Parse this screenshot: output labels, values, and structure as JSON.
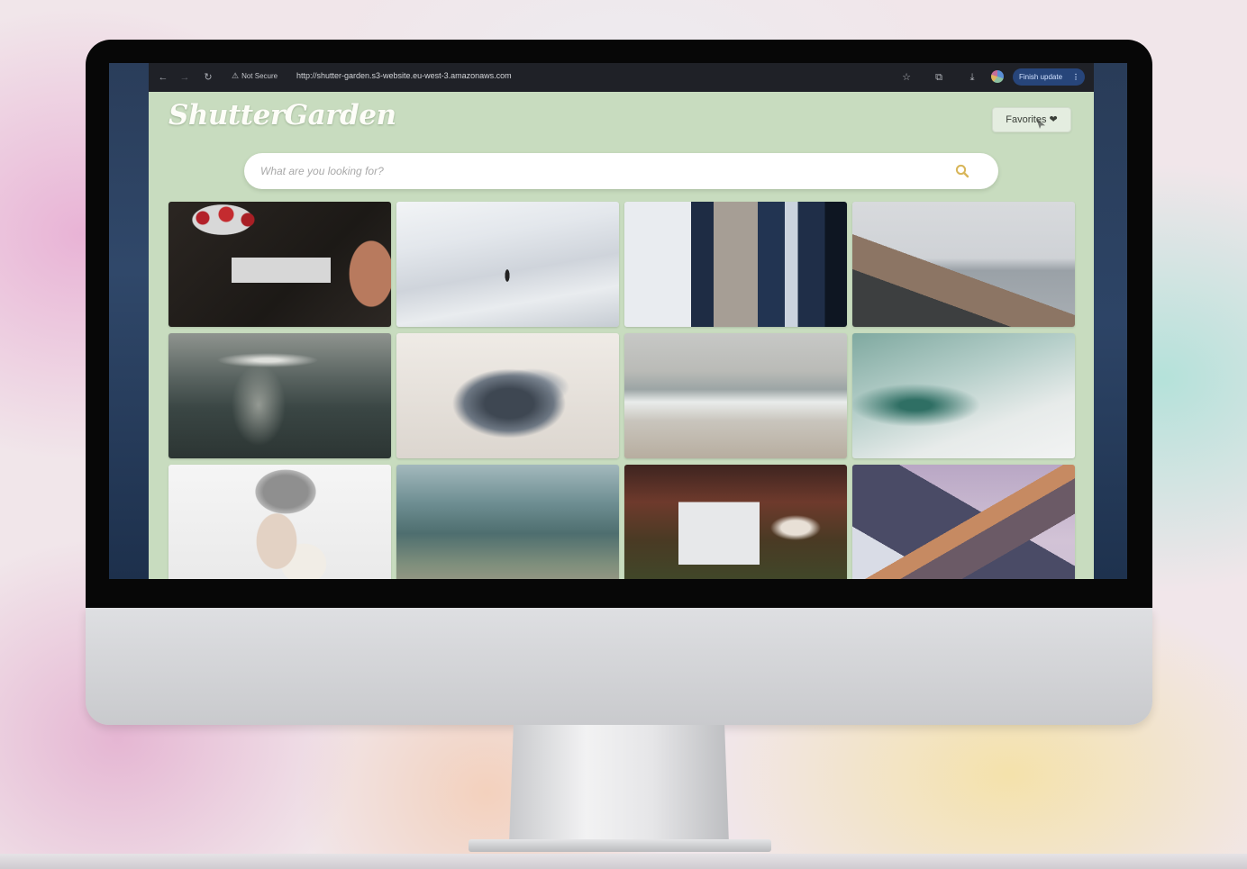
{
  "browser": {
    "security_label": "Not Secure",
    "url": "http://shutter-garden.s3-website.eu-west-3.amazonaws.com",
    "finish_update_label": "Finish update",
    "icons": [
      "back-arrow-icon",
      "forward-arrow-icon",
      "reload-icon",
      "warning-icon",
      "star-icon",
      "extensions-icon",
      "download-icon",
      "profile-icon",
      "more-vert-icon"
    ]
  },
  "app": {
    "logo_text": "ShutterGarden",
    "favorites_label": "Favorites ❤",
    "search": {
      "placeholder": "What are you looking for?",
      "icon": "search-icon"
    },
    "colors": {
      "page_background": "#c8dcbf",
      "logo": "#fdfdf8",
      "browser_bar": "#1f2127"
    },
    "gallery": {
      "columns": 4,
      "rows_visible": 3,
      "photos": [
        "cherries-and-toaster",
        "person-in-white-dunes",
        "blurred-city-reflection",
        "coastal-cliff-over-sea",
        "sunlight-on-sea",
        "crumpled-paper-sculpture",
        "breaking-waves",
        "misty-green-sea",
        "woman-in-knit-beanie",
        "clear-ocean-water",
        "computer-on-desk",
        "snowy-mountain-peak"
      ]
    }
  }
}
